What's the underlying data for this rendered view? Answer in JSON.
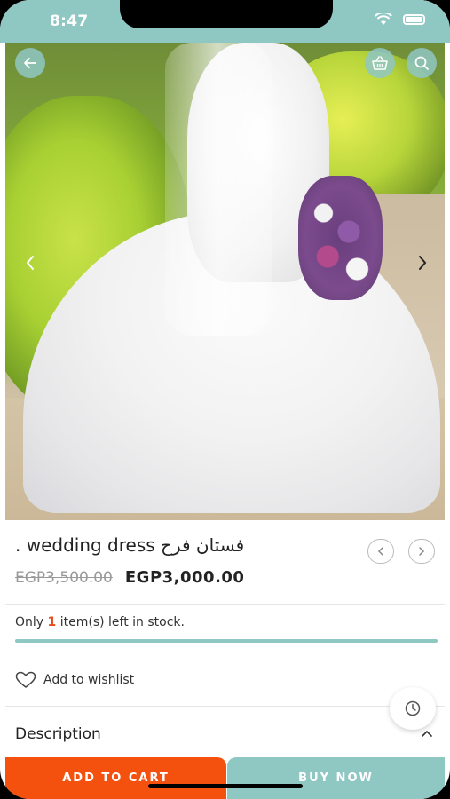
{
  "status_bar": {
    "time": "8:47"
  },
  "product": {
    "title": ". wedding dress فستان فرح",
    "old_price": "EGP3,500.00",
    "price": "EGP3,000.00"
  },
  "stock": {
    "prefix": "Only ",
    "count": "1",
    "suffix": " item(s) left in stock.",
    "level_fraction": 1.0
  },
  "wishlist": {
    "label": "Add to wishlist"
  },
  "description": {
    "label": "Description"
  },
  "actions": {
    "add_to_cart": "ADD TO CART",
    "buy_now": "BUY NOW"
  },
  "colors": {
    "accent": "#8fc7c3",
    "cart": "#f4510e",
    "stock_count": "#e64a19"
  },
  "icons": [
    "back-arrow-icon",
    "basket-icon",
    "search-icon",
    "chevron-left-icon",
    "chevron-right-icon",
    "heart-icon",
    "clock-icon",
    "chevron-up-icon",
    "wifi-icon",
    "battery-icon"
  ]
}
